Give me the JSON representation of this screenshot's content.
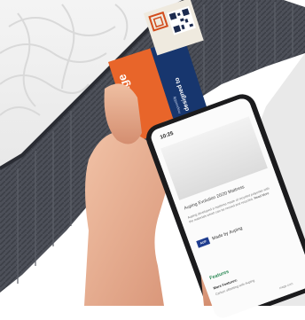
{
  "tag": {
    "brand": "niage",
    "tagline": "designed to",
    "subline": "responsibly",
    "colors": {
      "orange": "#e8652a",
      "navy": "#17366e",
      "cream": "#efeadf"
    }
  },
  "phone": {
    "status_time": "10:25",
    "heading": "Auping Evolution 20/20 Mattress",
    "body_text": "Auping developed a mattress made of recycled polyester with the materials which can be reused and recycled.",
    "read_more": "Read More",
    "badge_label": "AUP",
    "made_by": "Made by Auping",
    "features_title": "Features",
    "more_features": "More Features:",
    "feature_item": "Carbon offsetting with Auping",
    "site": "niage.com"
  }
}
